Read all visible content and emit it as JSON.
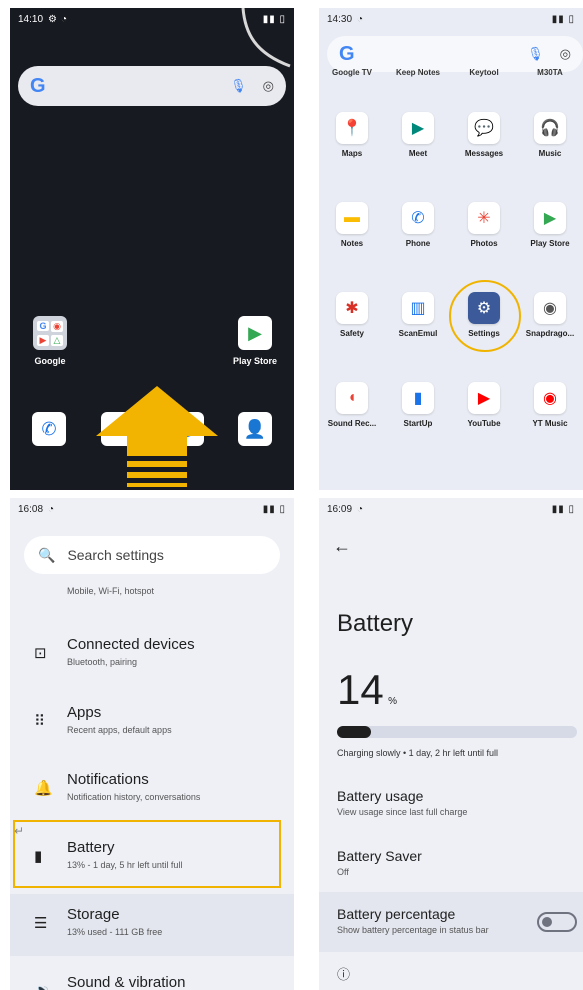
{
  "colors": {
    "highlight": "#f0b400",
    "arrow": "#f0b400",
    "accent": "#1a73e8"
  },
  "home": {
    "status_time": "14:10",
    "search_logo": "G",
    "folder_label": "Google",
    "play_label": "Play Store"
  },
  "drawer": {
    "status_time": "14:30",
    "search_logo": "G",
    "top_row": [
      "Google TV",
      "Keep Notes",
      "Keytool",
      "M30TA"
    ],
    "apps": [
      {
        "label": "Maps",
        "icon": "maps-icon"
      },
      {
        "label": "Meet",
        "icon": "meet-icon"
      },
      {
        "label": "Messages",
        "icon": "messages-icon"
      },
      {
        "label": "Music",
        "icon": "music-icon"
      },
      {
        "label": "Notes",
        "icon": "notes-icon"
      },
      {
        "label": "Phone",
        "icon": "phone-icon"
      },
      {
        "label": "Photos",
        "icon": "photos-icon"
      },
      {
        "label": "Play Store",
        "icon": "play-store-icon"
      },
      {
        "label": "Safety",
        "icon": "safety-icon"
      },
      {
        "label": "ScanEmul",
        "icon": "scan-icon"
      },
      {
        "label": "Settings",
        "icon": "settings-icon"
      },
      {
        "label": "Snapdrago...",
        "icon": "snapdragon-icon"
      },
      {
        "label": "Sound Rec...",
        "icon": "recorder-icon"
      },
      {
        "label": "StartUp",
        "icon": "startup-icon"
      },
      {
        "label": "YouTube",
        "icon": "youtube-icon"
      },
      {
        "label": "YT Music",
        "icon": "ytmusic-icon"
      }
    ]
  },
  "settings": {
    "status_time": "16:08",
    "search_placeholder": "Search settings",
    "partial_sub": "Mobile, Wi-Fi, hotspot",
    "items": [
      {
        "title": "Connected devices",
        "sub": "Bluetooth, pairing",
        "icon": "devices-icon"
      },
      {
        "title": "Apps",
        "sub": "Recent apps, default apps",
        "icon": "apps-grid-icon"
      },
      {
        "title": "Notifications",
        "sub": "Notification history, conversations",
        "icon": "bell-icon"
      },
      {
        "title": "Battery",
        "sub": "13% - 1 day, 5 hr left until full",
        "icon": "battery-icon"
      },
      {
        "title": "Storage",
        "sub": "13% used - 111 GB free",
        "icon": "storage-icon"
      },
      {
        "title": "Sound & vibration",
        "sub": "",
        "icon": "speaker-icon"
      }
    ]
  },
  "battery": {
    "status_time": "16:09",
    "page_title": "Battery",
    "level": "14",
    "level_unit": "%",
    "level_fraction": 0.14,
    "charging_text": "Charging slowly • 1 day, 2 hr left until full",
    "usage_title": "Battery usage",
    "usage_sub": "View usage since last full charge",
    "saver_title": "Battery Saver",
    "saver_sub": "Off",
    "percentage_title": "Battery percentage",
    "percentage_sub": "Show battery percentage in status bar"
  }
}
